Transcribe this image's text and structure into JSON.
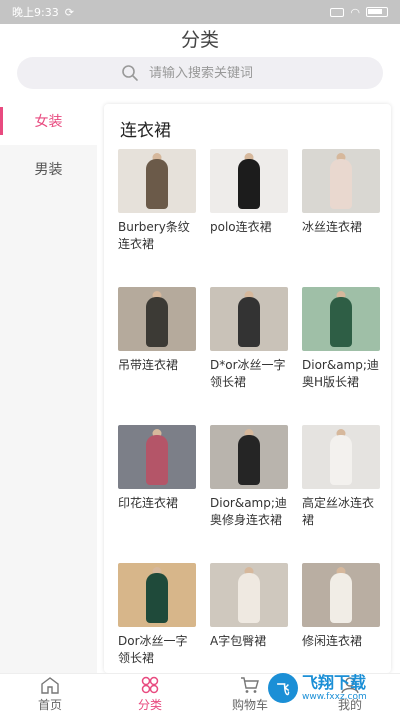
{
  "status_bar": {
    "time": "晚上9:33"
  },
  "header": {
    "title": "分类"
  },
  "search": {
    "placeholder": "请输入搜索关键词"
  },
  "sidebar": {
    "items": [
      {
        "label": "女装",
        "active": true
      },
      {
        "label": "男装",
        "active": false
      }
    ]
  },
  "section": {
    "title": "连衣裙"
  },
  "products": [
    {
      "label": "Burbery条纹连衣裙",
      "bg": "#e6e1da",
      "fg": "#6b5a49"
    },
    {
      "label": "polo连衣裙",
      "bg": "#eeecea",
      "fg": "#1c1c1c"
    },
    {
      "label": "冰丝连衣裙",
      "bg": "#d9d7d2",
      "fg": "#e9d8cf"
    },
    {
      "label": "吊带连衣裙",
      "bg": "#b5aa9c",
      "fg": "#3c3a35"
    },
    {
      "label": "D*or冰丝一字领长裙",
      "bg": "#c9c2b8",
      "fg": "#333333"
    },
    {
      "label": "Dior&amp;迪奥H版长裙",
      "bg": "#9fbfa7",
      "fg": "#2e5e45"
    },
    {
      "label": "印花连衣裙",
      "bg": "#7c7f88",
      "fg": "#b45568"
    },
    {
      "label": "Dior&amp;迪奥修身连衣裙",
      "bg": "#b9b4ad",
      "fg": "#252525"
    },
    {
      "label": "高定丝冰连衣裙",
      "bg": "#e5e3e0",
      "fg": "#f3f1ee"
    },
    {
      "label": "Dor冰丝一字领长裙",
      "bg": "#d7b68a",
      "fg": "#1f4a3a"
    },
    {
      "label": "A字包臀裙",
      "bg": "#cfc8be",
      "fg": "#efe9e1"
    },
    {
      "label": "修闲连衣裙",
      "bg": "#b9aea2",
      "fg": "#f1ede6"
    }
  ],
  "tabbar": {
    "items": [
      {
        "label": "首页"
      },
      {
        "label": "分类"
      },
      {
        "label": "购物车"
      },
      {
        "label": "我的"
      }
    ]
  },
  "watermark": {
    "logo_text": "飞",
    "main": "飞翔下载",
    "sub": "www.fxxz.com"
  },
  "colors": {
    "accent": "#e84a7f"
  }
}
